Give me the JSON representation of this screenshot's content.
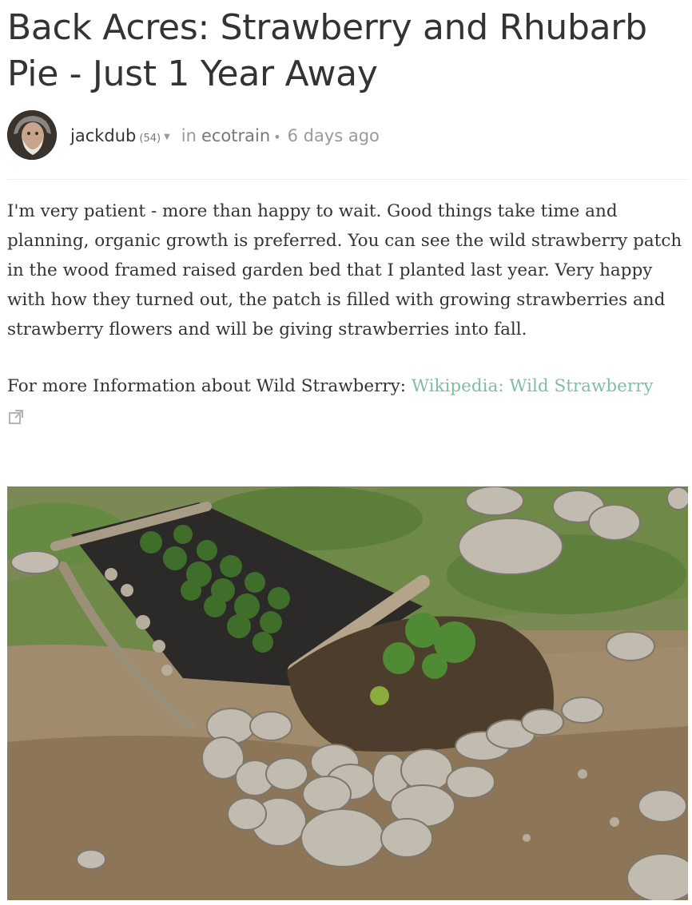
{
  "post": {
    "title": "Back Acres: Strawberry and Rhubarb Pie - Just 1 Year Away",
    "author": "jackdub",
    "reputation": "(54)",
    "in_label": "in",
    "community": "ecotrain",
    "separator": "•",
    "time_ago": "6 days ago",
    "paragraph1": "I'm very patient - more than happy to wait. Good things take time and planning, organic growth is preferred. You can see the wild strawberry patch in the wood framed raised garden bed that I planted last year. Very happy with how they turned out, the patch is filled with growing strawberries and strawberry flowers and will be giving strawberries into fall.",
    "more_info_label": "For more Information about Wild Strawberry: ",
    "link_text": "Wikipedia: Wild Strawberry"
  },
  "icons": {
    "author_menu": "caret-down-icon",
    "external_link": "external-link-icon"
  },
  "colors": {
    "text": "#333333",
    "muted": "#999999",
    "link": "#7fbf9e",
    "divider": "#eeeeee"
  }
}
